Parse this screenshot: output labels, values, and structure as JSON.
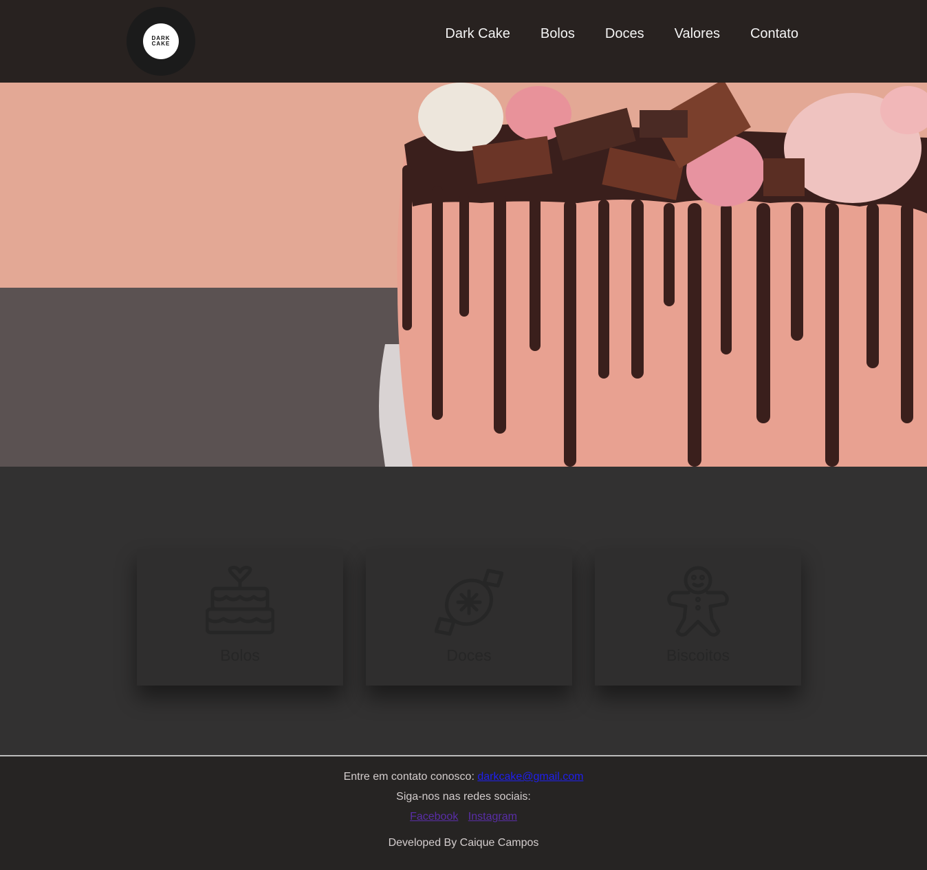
{
  "header": {
    "logo": {
      "line1": "DARK",
      "line2": "CAKE"
    },
    "nav": [
      "Dark Cake",
      "Bolos",
      "Doces",
      "Valores",
      "Contato"
    ]
  },
  "hero": {
    "image": "chocolate-drip-cake-photo"
  },
  "categories": [
    {
      "label": "Bolos",
      "icon": "cake-icon"
    },
    {
      "label": "Doces",
      "icon": "candy-icon"
    },
    {
      "label": "Biscoitos",
      "icon": "gingerbread-icon"
    }
  ],
  "footer": {
    "contact_text": "Entre em contato conosco: ",
    "email": "darkcake@gmail.com",
    "social_text": "Siga-nos nas redes sociais:",
    "facebook": "Facebook",
    "instagram": "Instagram",
    "credit": "Developed By Caique Campos"
  },
  "colors": {
    "header_bg": "#282220",
    "page_bg": "#323131",
    "card_bg": "#2f2e2e",
    "footer_bg": "#262423",
    "email_link": "#1f1ff0",
    "social_link": "#5a2ea8"
  }
}
